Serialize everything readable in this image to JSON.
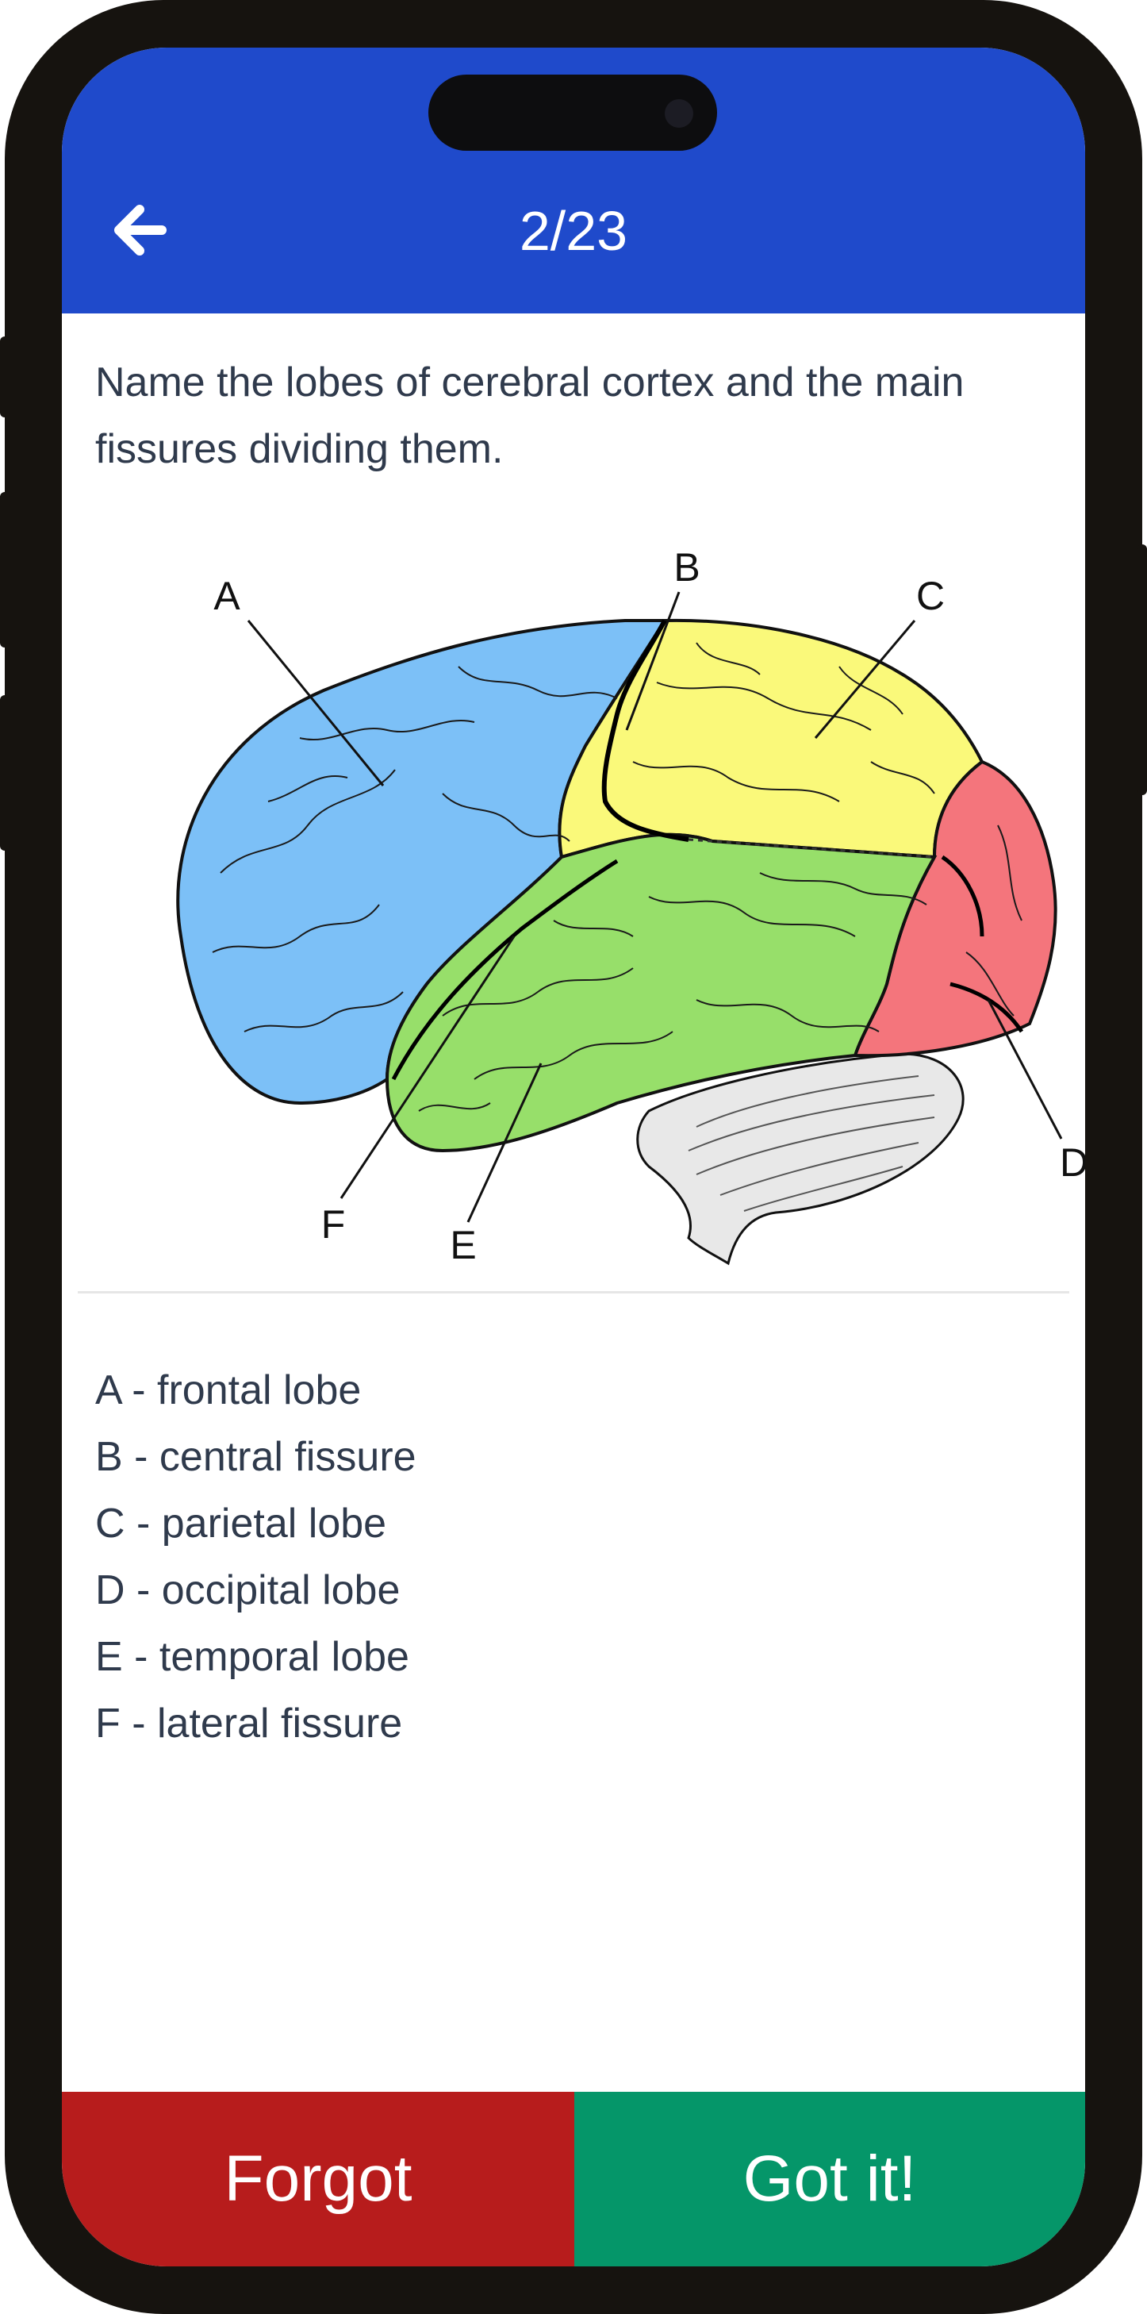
{
  "header": {
    "counter": "2/23",
    "back_icon": "arrow-left-icon"
  },
  "card": {
    "question": "Name the lobes of cerebral cortex and the main fissures dividing them.",
    "diagram": {
      "labels": [
        "A",
        "B",
        "C",
        "D",
        "E",
        "F"
      ],
      "colors": {
        "frontal": "#7cc0f7",
        "parietal": "#faf97a",
        "temporal": "#97df6a",
        "occipital": "#f4757c",
        "cerebellum": "#e8e8e8"
      }
    },
    "answers": [
      "A - frontal lobe",
      "B - central fissure",
      "C - parietal lobe",
      "D - occipital lobe",
      "E - temporal lobe",
      "F - lateral fissure"
    ]
  },
  "actions": {
    "forgot_label": "Forgot",
    "got_it_label": "Got it!"
  },
  "colors": {
    "header_bg": "#1f4acb",
    "forgot_bg": "#b71c1c",
    "got_it_bg": "#059669",
    "text": "#2f3a4c"
  }
}
